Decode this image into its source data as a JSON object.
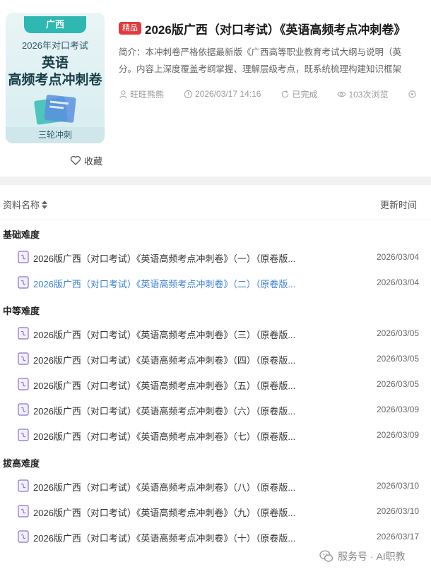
{
  "cover": {
    "region": "广西",
    "line1": "2026年对口考试",
    "line2": "英语",
    "line3": "高频考点冲刺卷",
    "footer": "三轮冲刺"
  },
  "favorite_label": "收藏",
  "header": {
    "badge": "精品",
    "title": "2026版广西（对口考试）《英语高频考点冲刺卷》",
    "intro_line1": "简介：本冲刺卷严格依据最新版《广西高等职业教育考试大纲与说明（英",
    "intro_line2": "分。内容上深度覆盖考纲掌握、理解层级考点，既系统梳理构建知识框架",
    "author": "旺旺熊熊",
    "datetime": "2026/03/17 14:16",
    "status": "已完成",
    "views": "103次浏览"
  },
  "list": {
    "col_name": "资料名称",
    "col_time": "更新时间",
    "groups": [
      {
        "title": "基础难度",
        "items": [
          {
            "name": "2026版广西（对口考试）《英语高频考点冲刺卷》（一）（原卷版...",
            "date": "2026/03/04"
          },
          {
            "name": "2026版广西（对口考试）《英语高频考点冲刺卷》（二）（原卷版...",
            "date": "2026/03/04"
          }
        ]
      },
      {
        "title": "中等难度",
        "items": [
          {
            "name": "2026版广西（对口考试）《英语高频考点冲刺卷》（三）（原卷版...",
            "date": "2026/03/05"
          },
          {
            "name": "2026版广西（对口考试）《英语高频考点冲刺卷》（四）（原卷版...",
            "date": "2026/03/05"
          },
          {
            "name": "2026版广西（对口考试）《英语高频考点冲刺卷》（五）（原卷版...",
            "date": "2026/03/05"
          },
          {
            "name": "2026版广西（对口考试）《英语高频考点冲刺卷》（六）（原卷版...",
            "date": "2026/03/09"
          },
          {
            "name": "2026版广西（对口考试）《英语高频考点冲刺卷》（七）（原卷版...",
            "date": "2026/03/09"
          }
        ]
      },
      {
        "title": "拔高难度",
        "items": [
          {
            "name": "2026版广西（对口考试）《英语高频考点冲刺卷》（八）（原卷版...",
            "date": "2026/03/10"
          },
          {
            "name": "2026版广西（对口考试）《英语高频考点冲刺卷》（九）（原卷版...",
            "date": "2026/03/10"
          },
          {
            "name": "2026版广西（对口考试）《英语高频考点冲刺卷》（十）（原卷版...",
            "date": "2026/03/17"
          }
        ]
      }
    ]
  },
  "watermark": "服务号 · AI职教",
  "colors": {
    "badge": "#e23b3b",
    "active_link": "#3b7fd8",
    "cover_accent": "#2fb7b1",
    "file_icon": "#8a6fd1"
  }
}
